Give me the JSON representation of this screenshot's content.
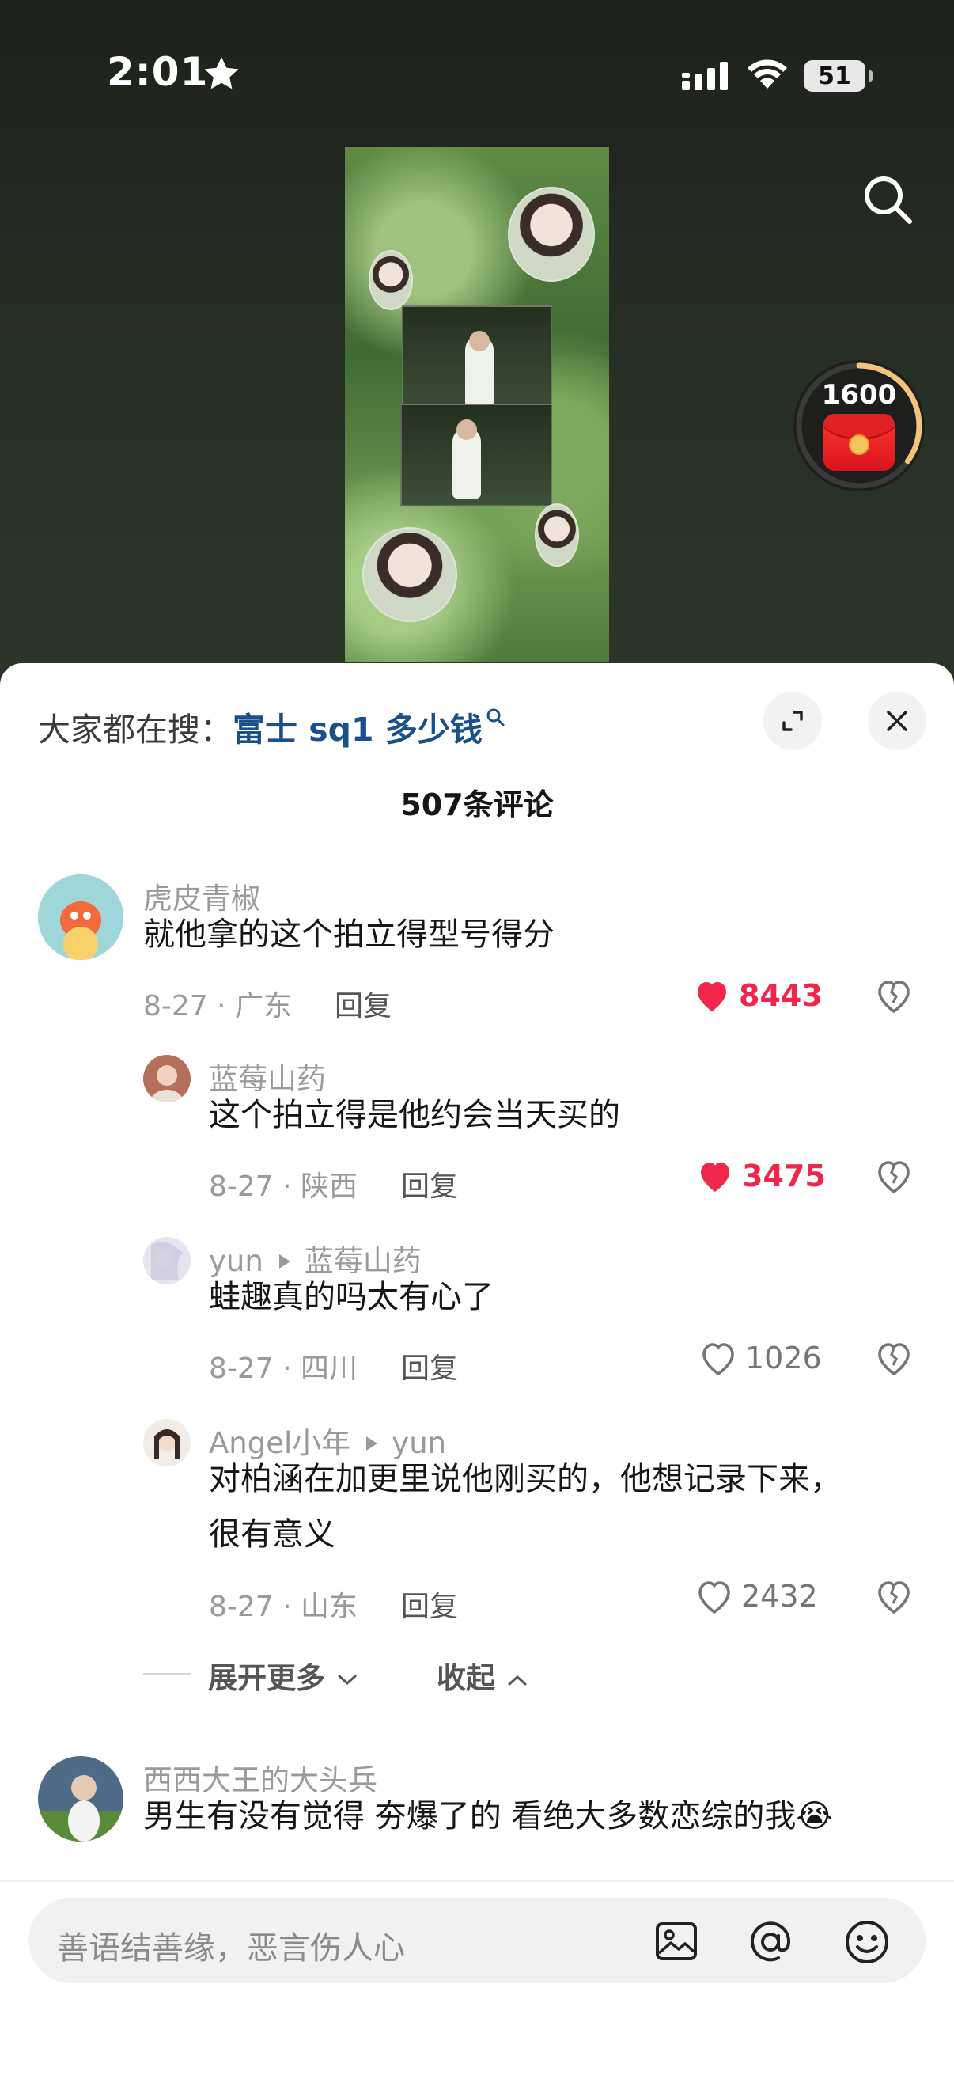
{
  "status_bar": {
    "time": "2:01",
    "battery": "51"
  },
  "reward": {
    "count": "1600",
    "progress": 0.35
  },
  "sheet": {
    "trending_prefix": "大家都在搜：",
    "trending_query": "富士 sq1 多少钱",
    "comment_count_title": "507条评论"
  },
  "comments": [
    {
      "user": "虎皮青椒",
      "text": "就他拿的这个拍立得型号得分",
      "meta": "8-27 · 广东",
      "reply_label": "回复",
      "likes": "8443",
      "liked": true
    },
    {
      "user": "蓝莓山药",
      "text": "这个拍立得是他约会当天买的",
      "meta": "8-27 · 陕西",
      "reply_label": "回复",
      "likes": "3475",
      "liked": true
    },
    {
      "user": "yun",
      "reply_to": "蓝莓山药",
      "text": "蛙趣真的吗太有心了",
      "meta": "8-27 · 四川",
      "reply_label": "回复",
      "likes": "1026",
      "liked": false
    },
    {
      "user": "Angel小年",
      "reply_to": "yun",
      "text_line1": "对柏涵在加更里说他刚买的，他想记录下来，",
      "text_line2": "很有意义",
      "meta": "8-27 · 山东",
      "reply_label": "回复",
      "likes": "2432",
      "liked": false
    },
    {
      "user": "西西大王的大头兵",
      "text": "男生有没有觉得 夯爆了的 看绝大多数恋综的我😭"
    }
  ],
  "thread_controls": {
    "expand_more": "展开更多",
    "collapse": "收起"
  },
  "input": {
    "placeholder": "善语结善缘，恶言伤人心"
  },
  "colors": {
    "like_red": "#f0264b",
    "trending_blue": "#1a4f8a",
    "reward_gold": "#f3c37a"
  },
  "icons": [
    "star-icon",
    "signal-icon",
    "wifi-icon",
    "battery-icon",
    "search-icon",
    "red-envelope-icon",
    "expand-icon",
    "close-icon",
    "heart-icon",
    "broken-heart-icon",
    "chevron-down-icon",
    "chevron-up-icon",
    "image-icon",
    "at-icon",
    "emoji-icon"
  ]
}
